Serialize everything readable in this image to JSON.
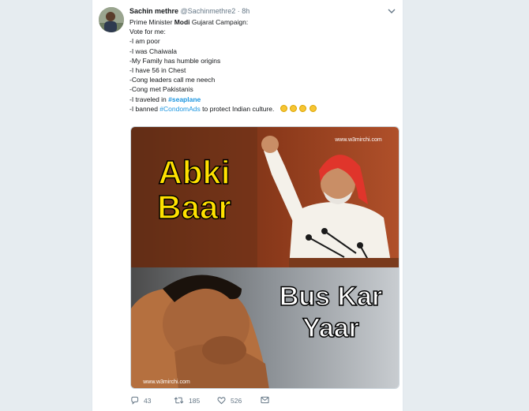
{
  "tweet": {
    "author_name": "Sachin methre",
    "author_handle": "@Sachinmethre2",
    "separator": "·",
    "time": "8h",
    "title_prefix": "Prime Minister ",
    "title_bold": "Modi",
    "title_suffix": " Gujarat Campaign:",
    "lines": [
      "Vote for me:",
      "-I am poor",
      "-I was Chaiwala",
      "-My Family has humble origins",
      "-I have 56 in Chest",
      "-Cong leaders call me neech",
      "-Cong met Pakistanis"
    ],
    "line_seaplane_prefix": "-I traveled in ",
    "hashtag_seaplane": "#seaplane",
    "line_condom_prefix": "-I banned ",
    "hashtag_condom": "#CondomAds",
    "line_condom_suffix": " to protect Indian culture.",
    "emoji_name": "clapping-hands",
    "emoji_count": 4
  },
  "media": {
    "top_text_line1": "Abki",
    "top_text_line2": "Baar",
    "bottom_text_line1": "Bus Kar",
    "bottom_text_line2": "Yaar",
    "watermark_top": "www.w3mirchi.com",
    "watermark_bottom": "www.w3mirchi.com"
  },
  "actions": {
    "reply_icon": "reply-icon",
    "reply_count": "43",
    "retweet_icon": "retweet-icon",
    "retweet_count": "185",
    "like_icon": "heart-icon",
    "like_count": "526",
    "message_icon": "envelope-icon"
  },
  "colors": {
    "page_bg": "#e6ecf0",
    "hashtag": "#1b95e0",
    "meta_gray": "#657786",
    "meme_yellow": "#ffe100"
  }
}
